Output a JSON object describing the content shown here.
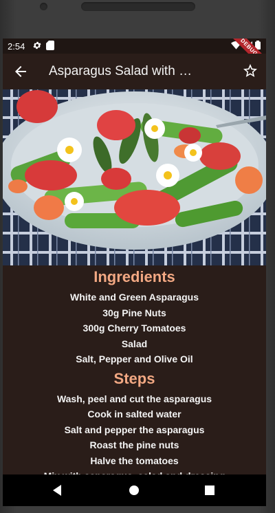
{
  "status": {
    "time": "2:54",
    "debug_label": "DEBUG"
  },
  "appbar": {
    "title": "Asparagus Salad with Cherry Tomatoes"
  },
  "ingredients": {
    "title": "Ingredients",
    "items": [
      "White and Green Asparagus",
      "30g Pine Nuts",
      "300g Cherry Tomatoes",
      "Salad",
      "Salt, Pepper and Olive Oil"
    ]
  },
  "steps": {
    "title": "Steps",
    "items": [
      "Wash, peel and cut the asparagus",
      "Cook in salted water",
      "Salt and pepper the asparagus",
      "Roast the pine nuts",
      "Halve the tomatoes",
      "Mix with asparagus, salad and dressing"
    ]
  },
  "colors": {
    "background": "#2a1d19",
    "accent": "#f2a883",
    "text": "#f4f4f4"
  },
  "icons": [
    "settings-icon",
    "sd-card-icon",
    "wifi-icon",
    "signal-icon",
    "battery-icon",
    "back-arrow-icon",
    "star-outline-icon",
    "nav-back-icon",
    "nav-home-icon",
    "nav-recents-icon"
  ]
}
